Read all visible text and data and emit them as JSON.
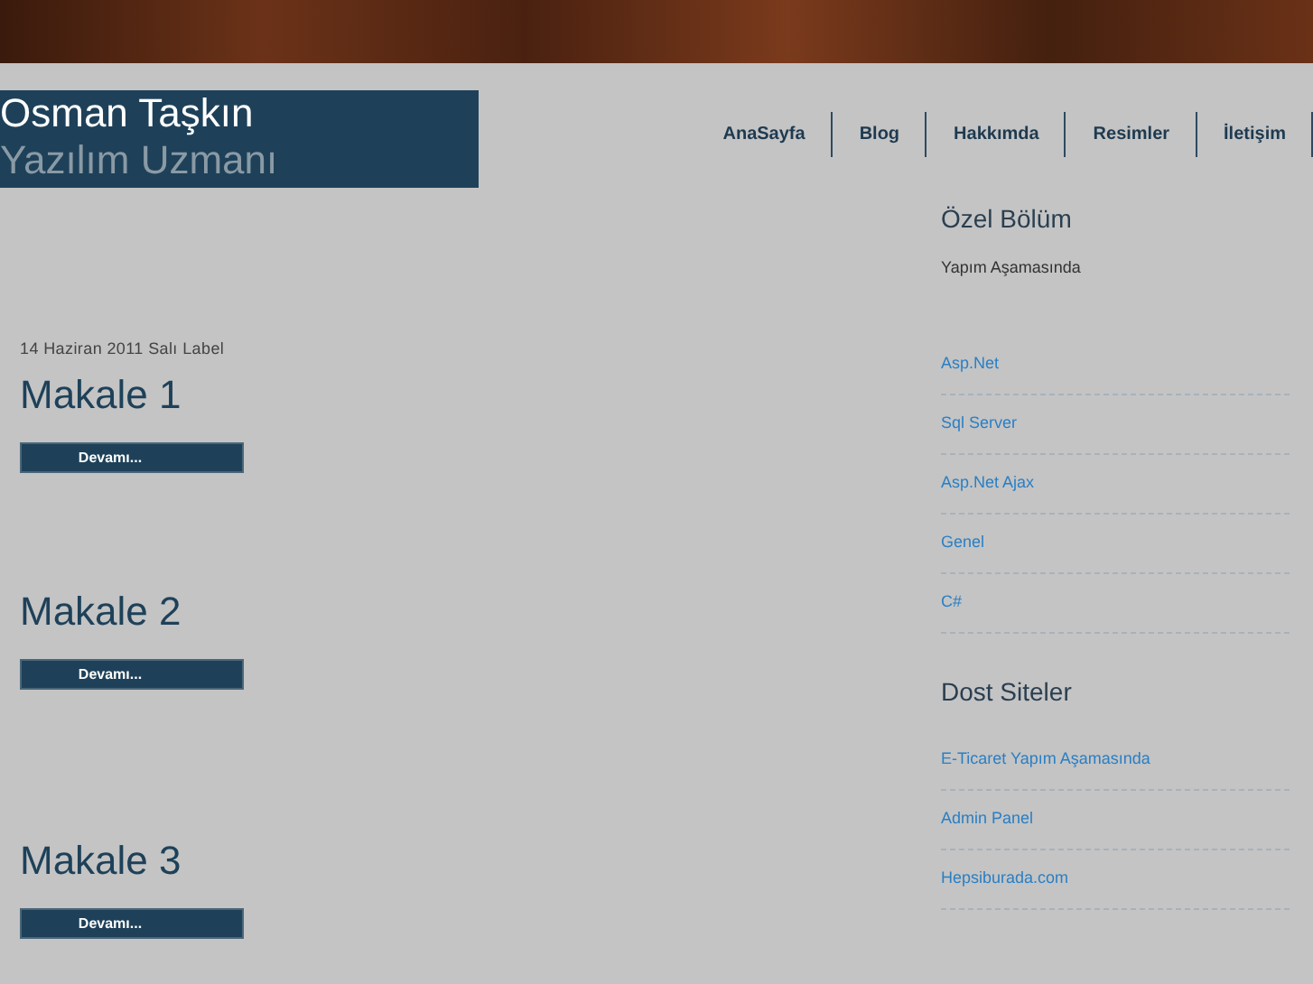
{
  "header": {
    "title": "Osman Taşkın",
    "subtitle": "Yazılım Uzmanı"
  },
  "nav": [
    {
      "label": "AnaSayfa"
    },
    {
      "label": "Blog"
    },
    {
      "label": "Hakkımda"
    },
    {
      "label": "Resimler"
    },
    {
      "label": "İletişim"
    }
  ],
  "posts": [
    {
      "meta": "14 Haziran 2011 Salı Label",
      "title": "Makale 1",
      "button": "Devamı..."
    },
    {
      "title": "Makale 2",
      "button": "Devamı..."
    },
    {
      "title": "Makale 3",
      "button": "Devamı..."
    }
  ],
  "sidebar": [
    {
      "title": "Özel Bölüm",
      "text": "Yapım Aşamasında",
      "links": [
        "Asp.Net",
        "Sql Server",
        "Asp.Net Ajax",
        "Genel",
        "C#"
      ]
    },
    {
      "title": "Dost Siteler",
      "links": [
        "E-Ticaret Yapım Aşamasında",
        "Admin Panel",
        "Hepsiburada.com"
      ]
    }
  ]
}
